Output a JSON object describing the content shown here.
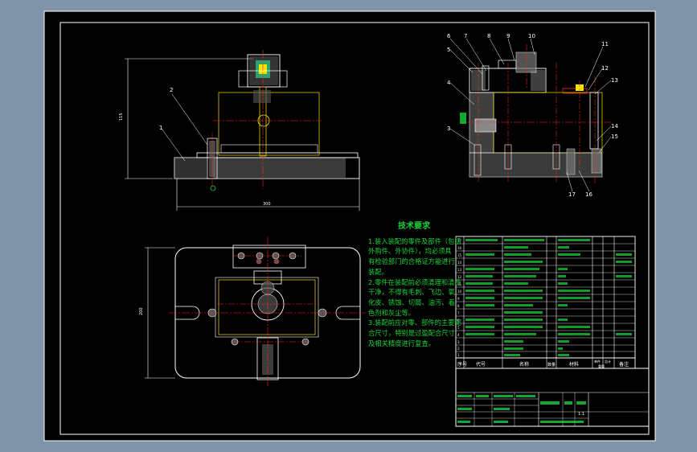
{
  "colors": {
    "bg_outer": "#7f94a8",
    "paper": "#000000",
    "white": "#ffffff",
    "yellow": "#f5e300",
    "red": "#ff2a2a",
    "green": "#19d23a",
    "cyan": "#00d7e6",
    "magenta": "#ff2bd8",
    "orange": "#ff9a1a"
  },
  "dimensions": {
    "height_label": "115",
    "width_label": "300",
    "plan_height_label": "200"
  },
  "callouts": [
    "1",
    "2",
    "3",
    "4",
    "5",
    "6",
    "7",
    "8",
    "9",
    "10",
    "11",
    "12",
    "13",
    "14",
    "15",
    "16",
    "17"
  ],
  "tech_requirements": {
    "title": "技术要求",
    "lines": [
      "1.装入装配的零件及部件（包括",
      "外购件、外协件），均必须具",
      "有检验部门的合格证方能进行",
      "装配。",
      "2.零件在装配前必须清理和清洗",
      "干净，不得有毛刺、飞边、氧",
      "化皮、锈蚀、切屑、油污、着",
      "色剂和灰尘等。",
      "3.装配前应对零、部件的主要配",
      "合尺寸，特别是过盈配合尺寸",
      "及相关精度进行复查。"
    ]
  },
  "bom_header": {
    "no": "序号",
    "code": "代号",
    "name": "名称",
    "qty": "数量",
    "material": "材料",
    "unit_weight": "单件",
    "total_weight": "总计",
    "weight": "重量",
    "remark": "备注"
  },
  "title_block": {
    "scale": "1:1",
    "labels": [
      "设计",
      "审核",
      "工艺",
      "标准化",
      "批准",
      "日期",
      "签名",
      "阶段标记",
      "重量",
      "比例"
    ]
  }
}
